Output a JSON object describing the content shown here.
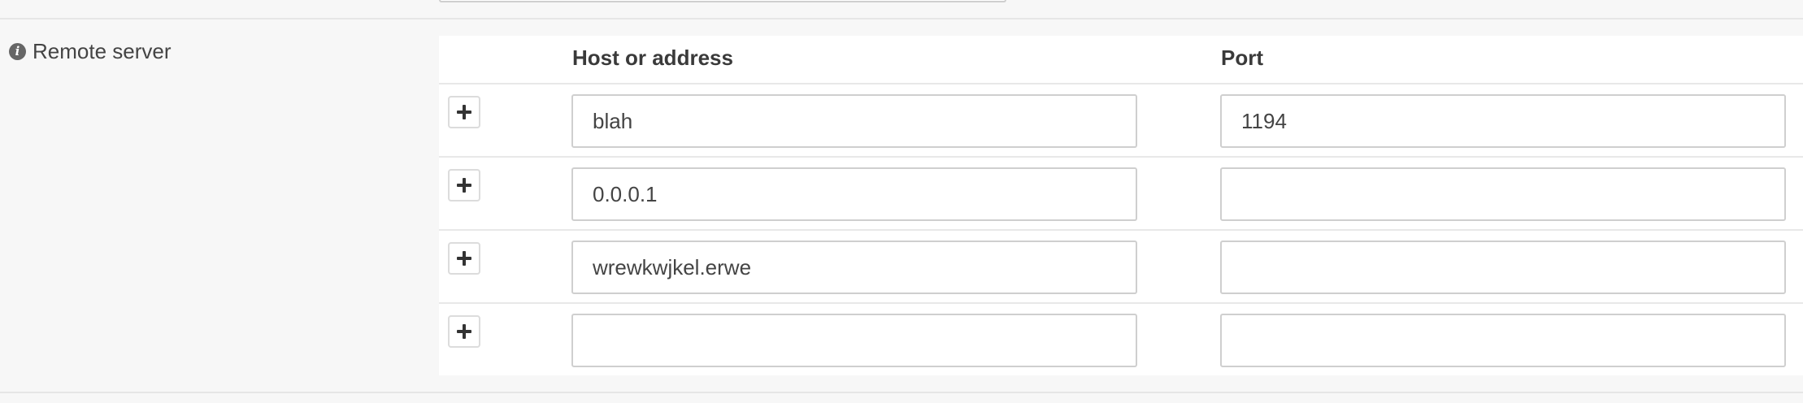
{
  "remote_server": {
    "label": "Remote server",
    "info_icon": "info-icon",
    "columns": {
      "host": "Host or address",
      "port": "Port"
    },
    "rows": [
      {
        "host": "blah",
        "port": "1194"
      },
      {
        "host": "0.0.0.1",
        "port": ""
      },
      {
        "host": "wrewkwjkel.erwe",
        "port": ""
      },
      {
        "host": "",
        "port": ""
      }
    ],
    "add_icon": "plus-icon"
  }
}
